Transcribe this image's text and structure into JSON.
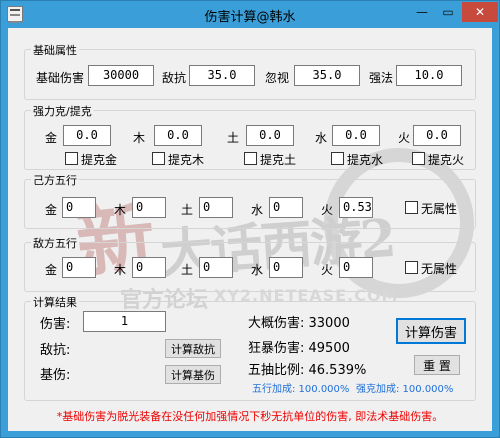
{
  "window": {
    "title": "伤害计算@韩水",
    "min_label": "—",
    "max_label": "▭",
    "close_label": "✕"
  },
  "watermark": {
    "line1": "新",
    "line2": "大话西游2",
    "line3": "官方论坛",
    "line4": "XY2.NETEASE.COM"
  },
  "basic": {
    "title": "基础属性",
    "damage_label": "基础伤害",
    "damage_value": "30000",
    "resist_label": "敌抗",
    "resist_value": "35.0",
    "ignore_label": "忽视",
    "ignore_value": "35.0",
    "strong_label": "强法",
    "strong_value": "10.0"
  },
  "strong_restraint": {
    "title": "强力克/提克",
    "items": [
      {
        "label": "金",
        "value": "0.0",
        "check_label": "提克金"
      },
      {
        "label": "木",
        "value": "0.0",
        "check_label": "提克木"
      },
      {
        "label": "土",
        "value": "0.0",
        "check_label": "提克土"
      },
      {
        "label": "水",
        "value": "0.0",
        "check_label": "提克水"
      },
      {
        "label": "火",
        "value": "0.0",
        "check_label": "提克火"
      }
    ]
  },
  "self_elements": {
    "title": "己方五行",
    "items": [
      {
        "label": "金",
        "value": "0"
      },
      {
        "label": "木",
        "value": "0"
      },
      {
        "label": "土",
        "value": "0"
      },
      {
        "label": "水",
        "value": "0"
      },
      {
        "label": "火",
        "value": "0.53"
      }
    ],
    "none_label": "无属性"
  },
  "enemy_elements": {
    "title": "敌方五行",
    "items": [
      {
        "label": "金",
        "value": "0"
      },
      {
        "label": "木",
        "value": "0"
      },
      {
        "label": "土",
        "value": "0"
      },
      {
        "label": "水",
        "value": "0"
      },
      {
        "label": "火",
        "value": "0"
      }
    ],
    "none_label": "无属性"
  },
  "results": {
    "title": "计算结果",
    "damage_label": "伤害:",
    "damage_value": "1",
    "resist_label": "敌抗:",
    "calc_resist_button": "计算敌抗",
    "base_label": "基伤:",
    "calc_base_button": "计算基伤",
    "approx_damage": "大概伤害: 33000",
    "crit_damage": "狂暴伤害: 49500",
    "ratio": "五抽比例: 46.539%",
    "calc_damage_button": "计算伤害",
    "reset_button": "重 置",
    "five_bonus": "五行加成: 100.000%",
    "strong_bonus": "强克加成: 100.000%"
  },
  "note": "*基础伤害为脱光装备在没任何加强情况下秒无抗单位的伤害, 即法术基础伤害。"
}
